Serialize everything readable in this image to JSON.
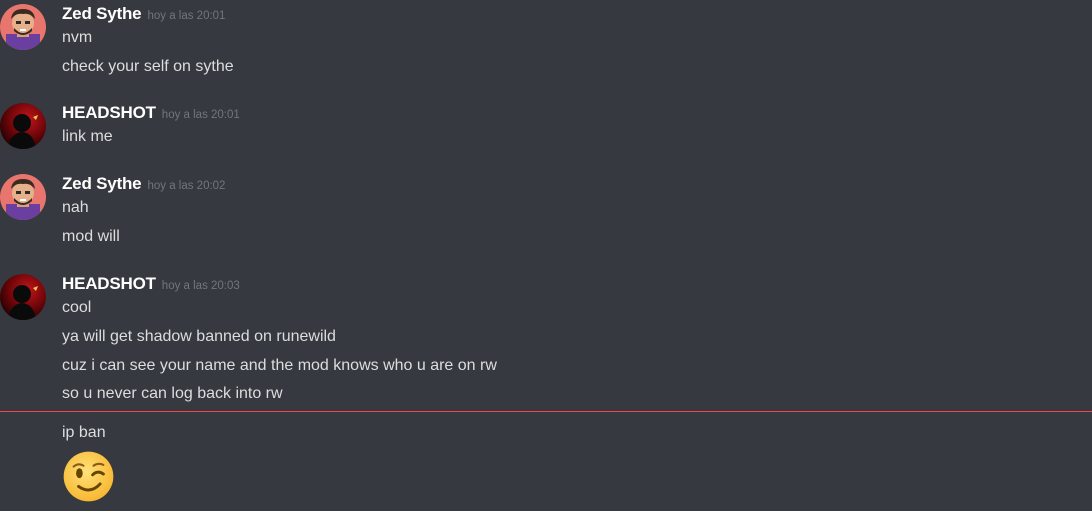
{
  "messages": [
    {
      "author": "Zed Sythe",
      "timestamp": "hoy a las 20:01",
      "avatar_icon": "cartoon-man-avatar",
      "lines": [
        "nvm",
        "check your self on sythe"
      ]
    },
    {
      "author": "HEADSHOT",
      "timestamp": "hoy a las 20:01",
      "avatar_icon": "dark-red-silhouette-avatar",
      "lines": [
        "link me"
      ]
    },
    {
      "author": "Zed Sythe",
      "timestamp": "hoy a las 20:02",
      "avatar_icon": "cartoon-man-avatar",
      "lines": [
        "nah",
        "mod will"
      ]
    },
    {
      "author": "HEADSHOT",
      "timestamp": "hoy a las 20:03",
      "avatar_icon": "dark-red-silhouette-avatar",
      "lines": [
        "cool",
        "ya will get shadow banned on runewild",
        "cuz i can see your name and the mod knows who u are on rw",
        "so u never can log back into rw"
      ]
    }
  ],
  "new_messages": {
    "lines": [
      "ip ban"
    ],
    "emoji": "winking-face-emoji"
  },
  "colors": {
    "background": "#36393f",
    "username": "#ffffff",
    "message_text": "#dcddde",
    "timestamp": "#72767d",
    "new_message_divider": "#f04747"
  }
}
